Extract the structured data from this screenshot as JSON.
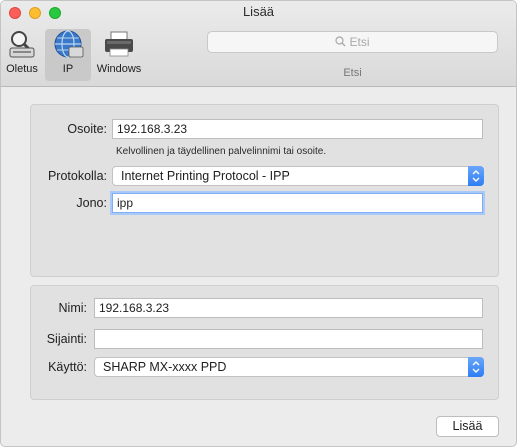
{
  "window": {
    "title": "Lisää"
  },
  "toolbar": {
    "items": [
      {
        "label": "Oletus",
        "icon": "default-printer-icon"
      },
      {
        "label": "IP",
        "icon": "globe-icon"
      },
      {
        "label": "Windows",
        "icon": "windows-printer-icon"
      }
    ],
    "search": {
      "placeholder": "Etsi",
      "caption": "Etsi"
    }
  },
  "address_section": {
    "address_label": "Osoite:",
    "address_value": "192.168.3.23",
    "address_hint": "Kelvollinen ja täydellinen palvelinnimi tai osoite.",
    "protocol_label": "Protokolla:",
    "protocol_value": "Internet Printing Protocol - IPP",
    "queue_label": "Jono:",
    "queue_value": "ipp"
  },
  "printer_section": {
    "name_label": "Nimi:",
    "name_value": "192.168.3.23",
    "location_label": "Sijainti:",
    "location_value": "",
    "use_label": "Käyttö:",
    "use_value": "SHARP MX-xxxx PPD"
  },
  "footer": {
    "add_button": "Lisää"
  },
  "colors": {
    "accent": "#2d7ef4",
    "focus_ring": "#a9c9f7",
    "close": "#fc5f57",
    "minimize": "#fdbd2e",
    "zoom": "#28c840"
  }
}
